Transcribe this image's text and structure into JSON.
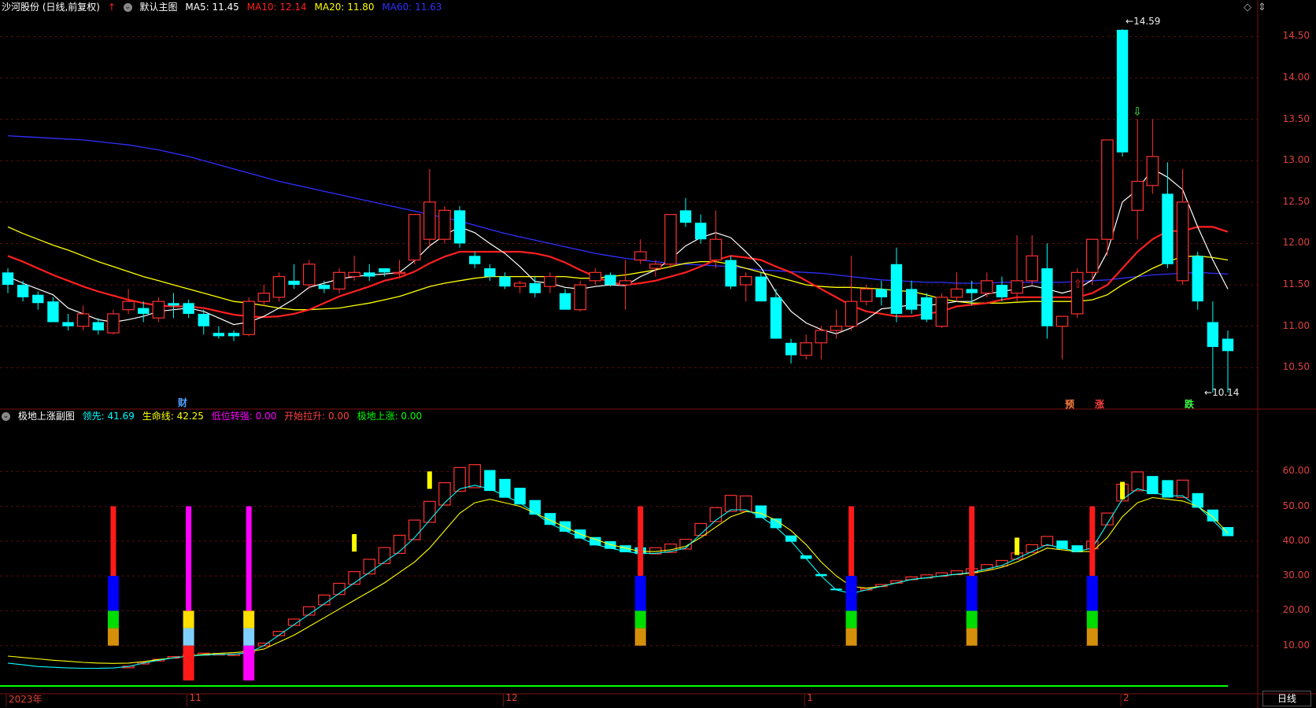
{
  "main_header": {
    "stock": "沙河股份 (日线,前复权)",
    "template": "默认主图",
    "ma5": "MA5: 11.45",
    "ma10": "MA10: 12.14",
    "ma20": "MA20: 11.80",
    "ma60": "MA60: 11.63",
    "colors": {
      "ma5": "#ffffff",
      "ma10": "#ff2020",
      "ma20": "#ffff00",
      "ma60": "#3030ff"
    }
  },
  "sub_header": {
    "name": "极地上涨副图",
    "lead": "领先: 41.69",
    "life": "生命线: 42.25",
    "low_turn": "低位转强: 0.00",
    "start_pull": "开始拉升: 0.00",
    "polar_rise": "极地上涨: 0.00",
    "colors": {
      "lead": "#00ffff",
      "life": "#ffff00",
      "low_turn": "#ff00ff",
      "start_pull": "#ff4040",
      "polar_rise": "#00ff00"
    }
  },
  "markers": {
    "cai": "财",
    "yu": "预",
    "zhang": "涨",
    "die": "跌",
    "high_label": "14.59",
    "low_label": "10.14"
  },
  "price_axis": [
    "14.50",
    "14.00",
    "13.50",
    "13.00",
    "12.50",
    "12.00",
    "11.50",
    "11.00",
    "10.50"
  ],
  "ind_axis": [
    "60.00",
    "50.00",
    "40.00",
    "30.00",
    "20.00",
    "10.00"
  ],
  "date_axis": [
    "2023年",
    "11",
    "12",
    "1",
    "2"
  ],
  "period_button": "日线",
  "icons": {
    "diamond": "diamond-icon",
    "scroll": "scroll-icon"
  },
  "chart_data": {
    "type": "candlestick",
    "up_color": "#ff3030",
    "down_color": "#00ffff",
    "price_range": [
      10.14,
      14.59
    ],
    "candles": [
      [
        11.65,
        11.7,
        11.4,
        11.5
      ],
      [
        11.5,
        11.55,
        11.3,
        11.35
      ],
      [
        11.38,
        11.42,
        11.2,
        11.28
      ],
      [
        11.3,
        11.35,
        11.05,
        11.05
      ],
      [
        11.05,
        11.15,
        10.95,
        11.0
      ],
      [
        11.0,
        11.25,
        10.95,
        11.15
      ],
      [
        11.05,
        11.1,
        10.9,
        10.95
      ],
      [
        10.92,
        11.2,
        10.9,
        11.15
      ],
      [
        11.2,
        11.45,
        11.15,
        11.3
      ],
      [
        11.22,
        11.3,
        11.05,
        11.15
      ],
      [
        11.1,
        11.35,
        11.05,
        11.3
      ],
      [
        11.28,
        11.4,
        11.1,
        11.25
      ],
      [
        11.28,
        11.32,
        11.1,
        11.15
      ],
      [
        11.15,
        11.2,
        10.9,
        11.0
      ],
      [
        10.92,
        11.0,
        10.85,
        10.88
      ],
      [
        10.92,
        10.95,
        10.82,
        10.88
      ],
      [
        10.9,
        11.35,
        10.88,
        11.3
      ],
      [
        11.3,
        11.5,
        11.25,
        11.4
      ],
      [
        11.35,
        11.65,
        11.3,
        11.6
      ],
      [
        11.55,
        11.75,
        11.45,
        11.5
      ],
      [
        11.5,
        11.8,
        11.45,
        11.75
      ],
      [
        11.5,
        11.55,
        11.4,
        11.45
      ],
      [
        11.45,
        11.7,
        11.4,
        11.65
      ],
      [
        11.6,
        11.85,
        11.55,
        11.65
      ],
      [
        11.65,
        11.75,
        11.55,
        11.6
      ],
      [
        11.7,
        11.65,
        11.6,
        11.65
      ],
      [
        11.65,
        11.8,
        11.6,
        11.65
      ],
      [
        11.8,
        12.35,
        11.75,
        12.35
      ],
      [
        12.05,
        12.9,
        11.95,
        12.5
      ],
      [
        12.05,
        12.45,
        12.0,
        12.4
      ],
      [
        12.4,
        12.45,
        11.95,
        12.0
      ],
      [
        11.85,
        11.9,
        11.7,
        11.75
      ],
      [
        11.7,
        11.75,
        11.55,
        11.6
      ],
      [
        11.6,
        11.65,
        11.45,
        11.48
      ],
      [
        11.48,
        11.55,
        11.4,
        11.52
      ],
      [
        11.52,
        11.6,
        11.35,
        11.4
      ],
      [
        11.48,
        11.65,
        11.4,
        11.6
      ],
      [
        11.4,
        11.45,
        11.2,
        11.2
      ],
      [
        11.2,
        11.55,
        11.18,
        11.5
      ],
      [
        11.55,
        11.7,
        11.5,
        11.65
      ],
      [
        11.62,
        11.65,
        11.48,
        11.5
      ],
      [
        11.5,
        11.8,
        11.2,
        11.55
      ],
      [
        11.8,
        12.05,
        11.75,
        11.9
      ],
      [
        11.7,
        11.8,
        11.6,
        11.75
      ],
      [
        11.75,
        12.35,
        11.7,
        12.35
      ],
      [
        12.4,
        12.55,
        12.2,
        12.25
      ],
      [
        12.25,
        12.35,
        12.0,
        12.05
      ],
      [
        11.8,
        12.4,
        11.7,
        12.05
      ],
      [
        11.8,
        11.85,
        11.45,
        11.48
      ],
      [
        11.5,
        11.65,
        11.3,
        11.6
      ],
      [
        11.6,
        11.65,
        11.3,
        11.3
      ],
      [
        11.35,
        11.45,
        10.85,
        10.85
      ],
      [
        10.8,
        10.85,
        10.55,
        10.65
      ],
      [
        10.65,
        10.9,
        10.6,
        10.8
      ],
      [
        10.8,
        11.0,
        10.6,
        10.95
      ],
      [
        10.95,
        11.2,
        10.85,
        11.0
      ],
      [
        11.0,
        11.85,
        10.95,
        11.3
      ],
      [
        11.3,
        11.5,
        11.25,
        11.45
      ],
      [
        11.45,
        11.55,
        11.25,
        11.35
      ],
      [
        11.75,
        11.95,
        11.05,
        11.15
      ],
      [
        11.45,
        11.55,
        11.15,
        11.2
      ],
      [
        11.35,
        11.4,
        11.05,
        11.08
      ],
      [
        11.0,
        11.4,
        10.98,
        11.35
      ],
      [
        11.35,
        11.65,
        11.3,
        11.45
      ],
      [
        11.45,
        11.55,
        11.25,
        11.4
      ],
      [
        11.4,
        11.65,
        11.35,
        11.55
      ],
      [
        11.5,
        11.6,
        11.3,
        11.35
      ],
      [
        11.4,
        12.1,
        11.3,
        11.55
      ],
      [
        11.55,
        12.1,
        11.5,
        11.85
      ],
      [
        11.7,
        12.0,
        10.85,
        11.0
      ],
      [
        11.0,
        11.1,
        10.6,
        11.12
      ],
      [
        11.15,
        11.7,
        11.1,
        11.65
      ],
      [
        11.65,
        12.05,
        11.5,
        12.05
      ],
      [
        12.05,
        13.25,
        11.85,
        13.25
      ],
      [
        14.58,
        14.59,
        13.05,
        13.1
      ],
      [
        12.4,
        13.5,
        12.05,
        12.75
      ],
      [
        12.7,
        13.5,
        12.6,
        13.05
      ],
      [
        12.6,
        12.98,
        11.7,
        11.75
      ],
      [
        11.55,
        12.9,
        11.5,
        12.5
      ],
      [
        11.85,
        11.9,
        11.2,
        11.3
      ],
      [
        11.05,
        11.3,
        10.2,
        10.75
      ],
      [
        10.85,
        10.95,
        10.2,
        10.7
      ]
    ],
    "ma5": [
      11.6,
      11.52,
      11.45,
      11.38,
      11.22,
      11.15,
      11.08,
      11.05,
      11.08,
      11.12,
      11.18,
      11.2,
      11.22,
      11.18,
      11.1,
      11.02,
      11.05,
      11.12,
      11.22,
      11.33,
      11.47,
      11.52,
      11.57,
      11.6,
      11.62,
      11.63,
      11.65,
      11.79,
      11.97,
      12.1,
      12.2,
      12.13,
      12.0,
      11.88,
      11.72,
      11.54,
      11.52,
      11.47,
      11.45,
      11.48,
      11.5,
      11.49,
      11.6,
      11.68,
      11.81,
      11.97,
      12.07,
      12.13,
      12.07,
      11.9,
      11.71,
      11.41,
      11.18,
      11.04,
      10.96,
      10.91,
      10.98,
      11.08,
      11.21,
      11.23,
      11.26,
      11.25,
      11.27,
      11.3,
      11.3,
      11.39,
      11.42,
      11.45,
      11.49,
      11.45,
      11.4,
      11.45,
      11.56,
      11.9,
      12.5,
      12.65,
      12.9,
      12.8,
      12.65,
      12.2,
      11.8,
      11.45
    ],
    "ma10": [
      11.85,
      11.78,
      11.7,
      11.62,
      11.55,
      11.48,
      11.42,
      11.37,
      11.32,
      11.28,
      11.25,
      11.24,
      11.24,
      11.22,
      11.18,
      11.14,
      11.12,
      11.11,
      11.12,
      11.15,
      11.2,
      11.28,
      11.36,
      11.42,
      11.48,
      11.55,
      11.59,
      11.66,
      11.76,
      11.84,
      11.9,
      11.9,
      11.9,
      11.9,
      11.9,
      11.88,
      11.84,
      11.77,
      11.68,
      11.6,
      11.53,
      11.5,
      11.52,
      11.55,
      11.6,
      11.65,
      11.72,
      11.8,
      11.85,
      11.83,
      11.8,
      11.72,
      11.65,
      11.55,
      11.45,
      11.35,
      11.25,
      11.18,
      11.15,
      11.12,
      11.12,
      11.15,
      11.18,
      11.24,
      11.26,
      11.28,
      11.32,
      11.35,
      11.35,
      11.35,
      11.35,
      11.35,
      11.4,
      11.5,
      11.7,
      11.9,
      12.05,
      12.15,
      12.15,
      12.2,
      12.2,
      12.14
    ],
    "ma20": [
      12.2,
      12.12,
      12.05,
      11.98,
      11.92,
      11.85,
      11.78,
      11.72,
      11.66,
      11.6,
      11.55,
      11.5,
      11.45,
      11.4,
      11.35,
      11.3,
      11.28,
      11.25,
      11.22,
      11.2,
      11.2,
      11.21,
      11.22,
      11.25,
      11.28,
      11.32,
      11.36,
      11.42,
      11.48,
      11.52,
      11.55,
      11.58,
      11.6,
      11.6,
      11.6,
      11.6,
      11.6,
      11.6,
      11.58,
      11.58,
      11.6,
      11.62,
      11.65,
      11.68,
      11.72,
      11.76,
      11.78,
      11.78,
      11.75,
      11.7,
      11.65,
      11.6,
      11.55,
      11.5,
      11.48,
      11.47,
      11.47,
      11.46,
      11.45,
      11.43,
      11.42,
      11.38,
      11.33,
      11.3,
      11.28,
      11.28,
      11.28,
      11.29,
      11.3,
      11.3,
      11.3,
      11.3,
      11.32,
      11.38,
      11.5,
      11.6,
      11.7,
      11.78,
      11.84,
      11.85,
      11.83,
      11.8
    ],
    "ma60": [
      13.3,
      13.29,
      13.28,
      13.27,
      13.26,
      13.25,
      13.23,
      13.21,
      13.19,
      13.16,
      13.13,
      13.09,
      13.05,
      13.0,
      12.95,
      12.9,
      12.85,
      12.8,
      12.75,
      12.71,
      12.67,
      12.63,
      12.59,
      12.55,
      12.51,
      12.47,
      12.43,
      12.39,
      12.35,
      12.31,
      12.27,
      12.22,
      12.17,
      12.12,
      12.08,
      12.04,
      12.0,
      11.96,
      11.92,
      11.88,
      11.85,
      11.82,
      11.8,
      11.78,
      11.76,
      11.75,
      11.74,
      11.73,
      11.72,
      11.7,
      11.68,
      11.67,
      11.66,
      11.65,
      11.64,
      11.62,
      11.6,
      11.58,
      11.56,
      11.55,
      11.54,
      11.53,
      11.53,
      11.52,
      11.52,
      11.52,
      11.53,
      11.53,
      11.53,
      11.53,
      11.53,
      11.54,
      11.55,
      11.56,
      11.58,
      11.6,
      11.62,
      11.63,
      11.64,
      11.65,
      11.64,
      11.63
    ],
    "indicator": {
      "range": [
        0,
        70
      ],
      "lead": [
        5,
        4.5,
        4,
        3.8,
        3.6,
        3.5,
        3.5,
        3.6,
        4,
        5,
        5.8,
        6.5,
        7,
        7.3,
        7.5,
        7.5,
        8,
        10,
        13,
        16,
        19,
        22,
        25,
        28,
        31,
        34,
        37,
        41,
        46,
        51,
        55,
        56,
        55,
        53,
        51,
        48,
        45,
        43,
        41,
        39,
        38,
        37,
        36.5,
        36.5,
        37,
        38,
        42,
        46,
        49,
        49,
        47,
        44,
        40,
        35,
        30,
        26,
        25,
        26,
        27,
        28,
        29,
        29.5,
        30,
        30.5,
        31,
        32,
        33,
        35,
        37,
        39,
        38,
        37,
        38,
        45,
        52,
        55,
        54,
        53,
        53,
        50,
        46,
        41.69
      ],
      "life": [
        7,
        6.6,
        6.2,
        5.8,
        5.5,
        5.2,
        5,
        4.9,
        5,
        5.4,
        6,
        6.5,
        7,
        7.5,
        7.8,
        8,
        8.3,
        9,
        11,
        13,
        15.5,
        18,
        20.5,
        23,
        25.5,
        28,
        31,
        34,
        38,
        43,
        48,
        51,
        52,
        51,
        50,
        48,
        46,
        44,
        42,
        40.5,
        39,
        38,
        37,
        37,
        37.5,
        38.5,
        41,
        44,
        47,
        48.5,
        48,
        46,
        43,
        39,
        34,
        30,
        27,
        26.5,
        27,
        28,
        29,
        29.5,
        30,
        30.5,
        30.8,
        31.5,
        32.5,
        34,
        36,
        38,
        37.5,
        37,
        37,
        41,
        47,
        51,
        52.5,
        52,
        51.5,
        50,
        47,
        42.25
      ],
      "bars": [
        0,
        0,
        0,
        0,
        0,
        0,
        0,
        0,
        0.5,
        1,
        1.5,
        2,
        2.5,
        3,
        1.5,
        0.5,
        3,
        4,
        6,
        9,
        12,
        14,
        16,
        18,
        21,
        23,
        26,
        28,
        30,
        32,
        34,
        33,
        30,
        27,
        24,
        21,
        17,
        15,
        13,
        12,
        11,
        10,
        9.5,
        9,
        12,
        14,
        17,
        20,
        23,
        22,
        18,
        14,
        9,
        5,
        3,
        2,
        2,
        2.5,
        3,
        3.5,
        4,
        4.5,
        5,
        5.5,
        6,
        7,
        8,
        9,
        11,
        13,
        12,
        10,
        11,
        17,
        24,
        27,
        26,
        25,
        25,
        21,
        17,
        13
      ]
    }
  }
}
